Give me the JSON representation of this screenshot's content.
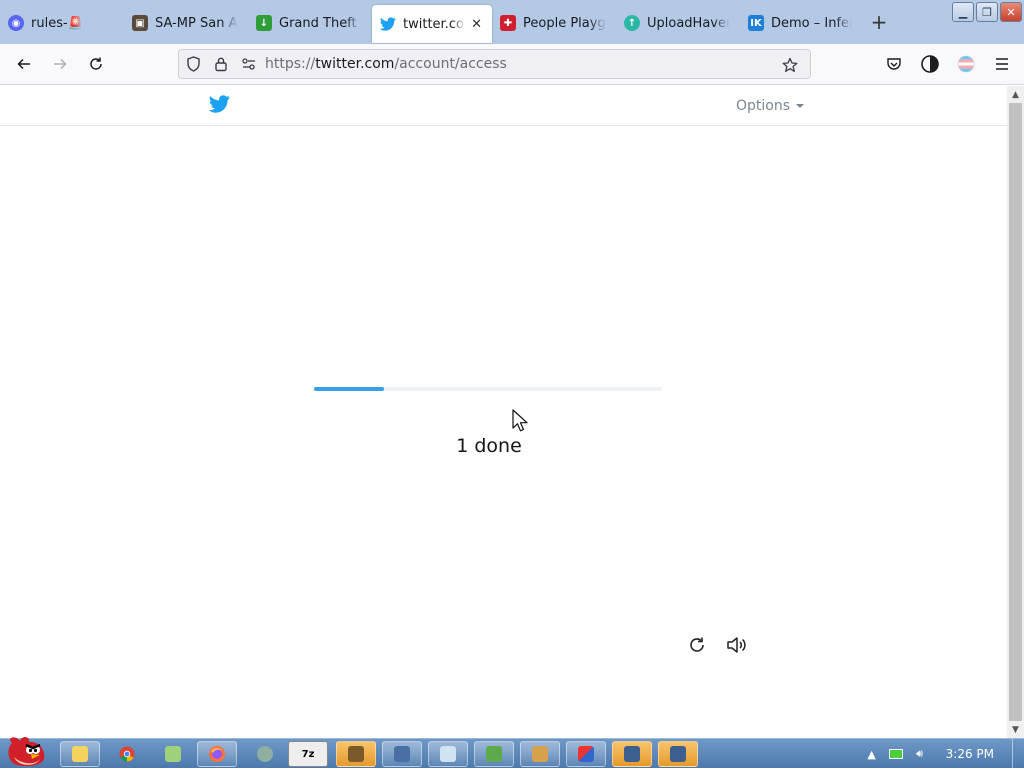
{
  "browser": {
    "tabs": [
      {
        "title": "rules-🚨",
        "icon": "discord-icon",
        "color": "#5865f2"
      },
      {
        "title": "SA-MP San An",
        "icon": "samp-icon",
        "color": "#5a4a3a"
      },
      {
        "title": "Grand Theft A",
        "icon": "download-arrow-icon",
        "color": "#2e9d3a"
      },
      {
        "title": "twitter.com/",
        "icon": "twitter-bird-icon",
        "color": "#1da1f2",
        "active": true
      },
      {
        "title": "People Playgr",
        "icon": "people-playground-icon",
        "color": "#d11f2f"
      },
      {
        "title": "UploadHaven",
        "icon": "uploadhaven-icon",
        "color": "#2bb7a6"
      },
      {
        "title": "Demo – InferK",
        "icon": "inferkit-icon",
        "color": "#1e7fd8"
      }
    ],
    "url": {
      "prefix": "https://",
      "host": "twitter.com",
      "path": "/account/access"
    }
  },
  "page": {
    "options_label": "Options",
    "progress_fraction": 0.2,
    "status_text": "1 done"
  },
  "taskbar": {
    "clock": "3:26 PM"
  }
}
